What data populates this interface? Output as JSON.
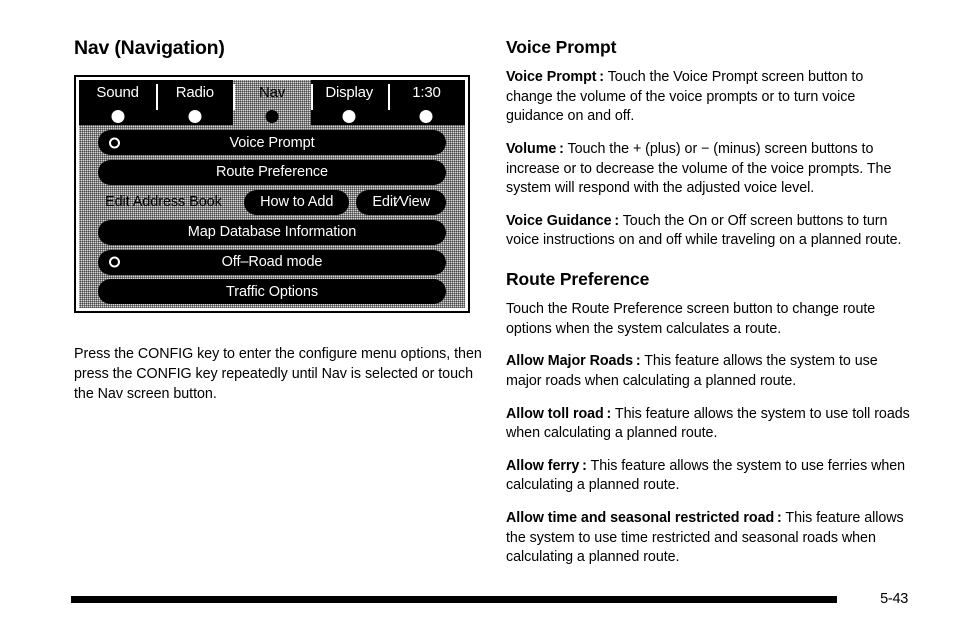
{
  "left_column": {
    "section_title": "Nav (Navigation)",
    "screen": {
      "tabs": [
        {
          "label": "Sound",
          "selected": false
        },
        {
          "label": "Radio",
          "selected": false
        },
        {
          "label": "Nav",
          "selected": true
        },
        {
          "label": "Display",
          "selected": false
        },
        {
          "label": "1:30",
          "selected": false
        }
      ],
      "menu_items": [
        {
          "type": "button",
          "label": "Voice Prompt",
          "radio": true
        },
        {
          "type": "button",
          "label": "Route Preference",
          "radio": false
        },
        {
          "type": "address_row",
          "label": "Edit Address Book",
          "buttons": [
            "How to Add",
            "Edit∕View"
          ]
        },
        {
          "type": "button",
          "label": "Map Database Information",
          "radio": false
        },
        {
          "type": "button",
          "label": "Off–Road mode",
          "radio": true
        },
        {
          "type": "button",
          "label": "Traffic Options",
          "radio": false
        }
      ]
    },
    "caption": "Press the CONFIG key to enter the configure menu options, then press the CONFIG key repeatedly until Nav is selected or touch the Nav screen button."
  },
  "right_column": {
    "voice_prompt": {
      "heading": "Voice Prompt",
      "paragraphs": [
        {
          "lead": "Voice Prompt :",
          "text": " Touch the Voice Prompt screen button to change the volume of the voice prompts or to turn voice guidance on and off."
        },
        {
          "lead": "Volume :",
          "text": " Touch the + (plus) or − (minus) screen buttons to increase or to decrease the volume of the voice prompts. The system will respond with the adjusted voice level."
        },
        {
          "lead": "Voice Guidance :",
          "text": " Touch the On or Off screen buttons to turn voice instructions on and off while traveling on a planned route."
        }
      ]
    },
    "route_preference": {
      "heading": "Route Preference",
      "intro": "Touch the Route Preference screen button to change route options when the system calculates a route.",
      "paragraphs": [
        {
          "lead": "Allow Major Roads :",
          "text": " This feature allows the system to use major roads when calculating a planned route."
        },
        {
          "lead": "Allow toll road :",
          "text": " This feature allows the system to use toll roads when calculating a planned route."
        },
        {
          "lead": "Allow ferry :",
          "text": " This feature allows the system to use ferries when calculating a planned route."
        },
        {
          "lead": "Allow time and seasonal restricted road :",
          "text": " This feature allows the system to use time restricted and seasonal roads when calculating a planned route."
        }
      ]
    }
  },
  "footer": {
    "page_number": "5-43"
  }
}
